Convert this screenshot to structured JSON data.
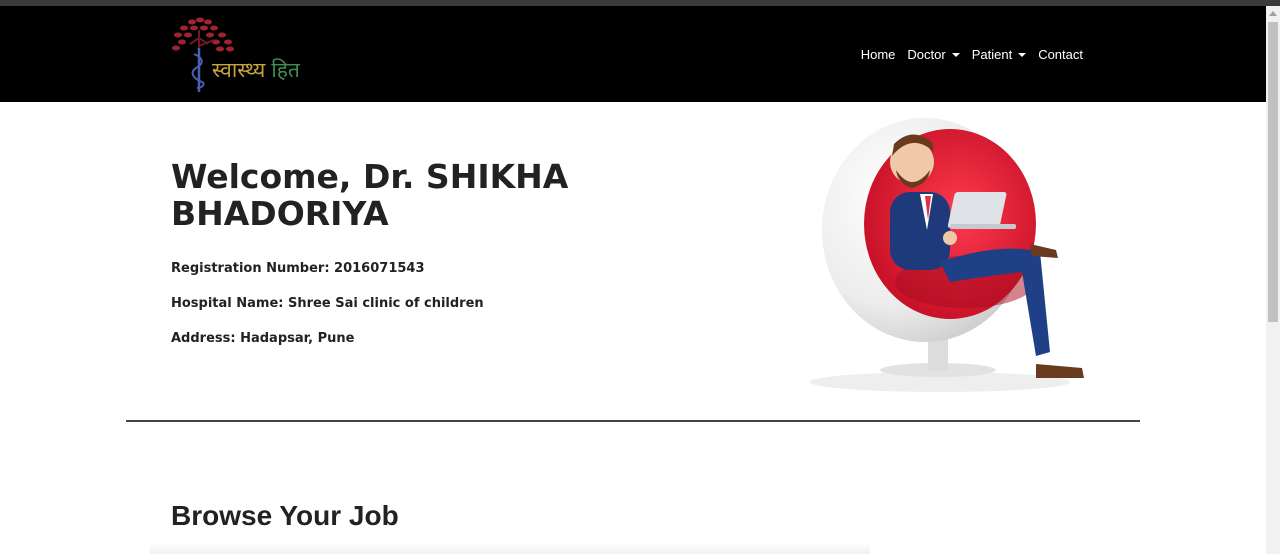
{
  "navbar": {
    "logo": {
      "word1": "स्वास्थ्य",
      "word2": "हित"
    },
    "links": [
      {
        "label": "Home",
        "dropdown": false
      },
      {
        "label": "Doctor",
        "dropdown": true
      },
      {
        "label": "Patient",
        "dropdown": true
      },
      {
        "label": "Contact",
        "dropdown": false
      }
    ]
  },
  "profile": {
    "welcome": "Welcome, Dr. SHIKHA BHADORIYA",
    "registration": "Registration Number: 2016071543",
    "hospital": "Hospital Name: Shree Sai clinic of children",
    "address": "Address: Hadapsar, Pune"
  },
  "section": {
    "title": "Browse Your Job"
  },
  "colors": {
    "navbar_bg": "#000000",
    "logo_tree": "#a0242f",
    "logo_caduceus": "#4a5fb0",
    "logo_word1": "#c9a43a",
    "logo_word2": "#3f8f52",
    "chair_red": "#d8172f",
    "text": "#222222"
  }
}
